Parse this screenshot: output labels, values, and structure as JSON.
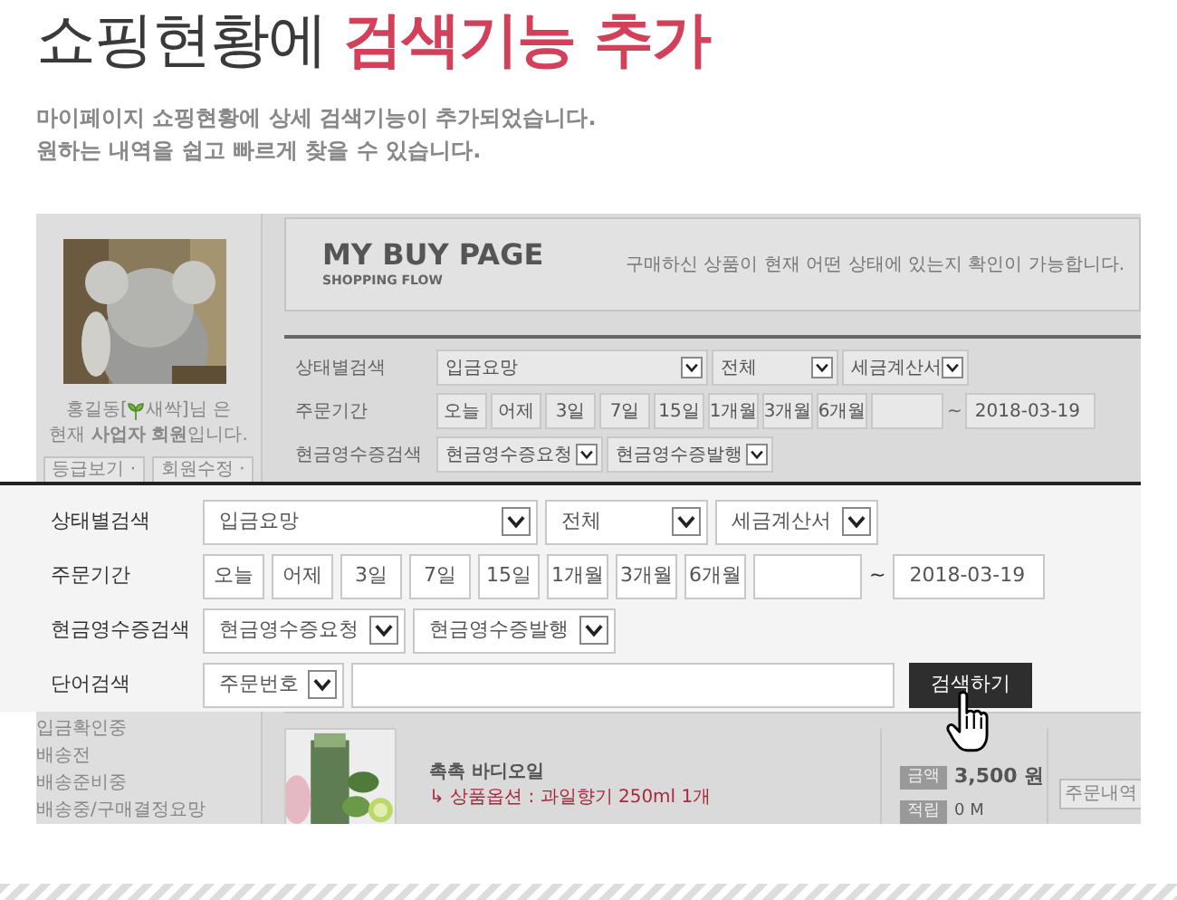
{
  "headline": {
    "text": "쇼핑현황에",
    "highlight": "검색기능 추가"
  },
  "description": [
    "마이페이지 쇼핑현황에 상세 검색기능이 추가되었습니다.",
    "원하는 내역을 쉽고 빠르게 찾을 수 있습니다."
  ],
  "profile": {
    "name_prefix": "홍길동[",
    "grade": "새싹",
    "name_suffix": "]님 은",
    "membership": "현재 **사업자 회원**입니다.",
    "buttons": [
      "등급보기 ·",
      "회원수정 ·"
    ]
  },
  "menu": [
    "입금확인중",
    "배송전",
    "배송준비중",
    "배송중/구매결정요망"
  ],
  "page_header": {
    "title": "MY BUY PAGE",
    "subtitle": "SHOPPING FLOW",
    "note": "구매하신 상품이 현재 어떤 상태에 있는지 확인이 가능합니다."
  },
  "background_search": [
    {
      "kind": "selects",
      "label": "상태별검색",
      "selects": [
        "입금요망",
        "전체",
        "세금계산서"
      ]
    },
    {
      "kind": "period",
      "label": "주문기간",
      "buttons": [
        "오늘",
        "어제",
        "3일",
        "7일",
        "15일",
        "1개월",
        "3개월",
        "6개월"
      ],
      "separator": "~",
      "date_to": "2018-03-19"
    },
    {
      "kind": "selects",
      "label": "현금영수증검색",
      "selects": [
        "현금영수증요청",
        "현금영수증발행"
      ]
    }
  ],
  "search_panel": [
    {
      "kind": "selects",
      "label": "상태별검색",
      "selects": [
        "입금요망",
        "전체",
        "세금계산서"
      ]
    },
    {
      "kind": "period",
      "label": "주문기간",
      "buttons": [
        "오늘",
        "어제",
        "3일",
        "7일",
        "15일",
        "1개월",
        "3개월",
        "6개월"
      ],
      "separator": "~",
      "date_to": "2018-03-19"
    },
    {
      "kind": "selects",
      "label": "현금영수증검색",
      "selects": [
        "현금영수증요청",
        "현금영수증발행"
      ]
    },
    {
      "kind": "word",
      "label": "단어검색",
      "select": "주문번호",
      "button": "검색하기"
    }
  ],
  "order": {
    "product": "촉촉 바디오일",
    "option": "↳ 상품옵션 : 과일향기 250ml 1개",
    "price_label": "금액",
    "price": "3,500 원",
    "points_label": "적립",
    "points": "0 M",
    "action": "주문내역"
  }
}
